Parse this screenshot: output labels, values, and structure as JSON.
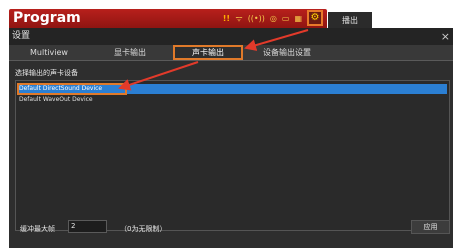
{
  "main_window": {
    "title": "Program",
    "output_tab": "播出",
    "toolbar_icons": [
      {
        "name": "warning-icon",
        "glyph": "!!"
      },
      {
        "name": "wifi-icon",
        "glyph": "ᯤ"
      },
      {
        "name": "broadcast-icon",
        "glyph": "((•))"
      },
      {
        "name": "record-icon",
        "glyph": "◎"
      },
      {
        "name": "monitor-icon",
        "glyph": "▭"
      },
      {
        "name": "grid-icon",
        "glyph": "▦"
      },
      {
        "name": "gear-icon",
        "glyph": "⚙"
      }
    ]
  },
  "dialog": {
    "title": "设置",
    "close_glyph": "×",
    "tabs": [
      {
        "label": "Multiview"
      },
      {
        "label": "显卡输出"
      },
      {
        "label": "声卡输出"
      },
      {
        "label": "设备输出设置"
      }
    ],
    "section_label": "选择输出的声卡设备",
    "devices": [
      {
        "label": "Default DirectSound Device"
      },
      {
        "label": "Default WaveOut Device"
      }
    ],
    "footer": {
      "buffer_label": "缓冲最大帧",
      "buffer_value": "2",
      "hint": "（0为无限制）",
      "apply_label": "应用"
    }
  },
  "colors": {
    "title_bar": "#b8201c",
    "highlight": "#e07a2a",
    "selection": "#2b7fd3",
    "dialog_bg": "#2e2e2e"
  }
}
